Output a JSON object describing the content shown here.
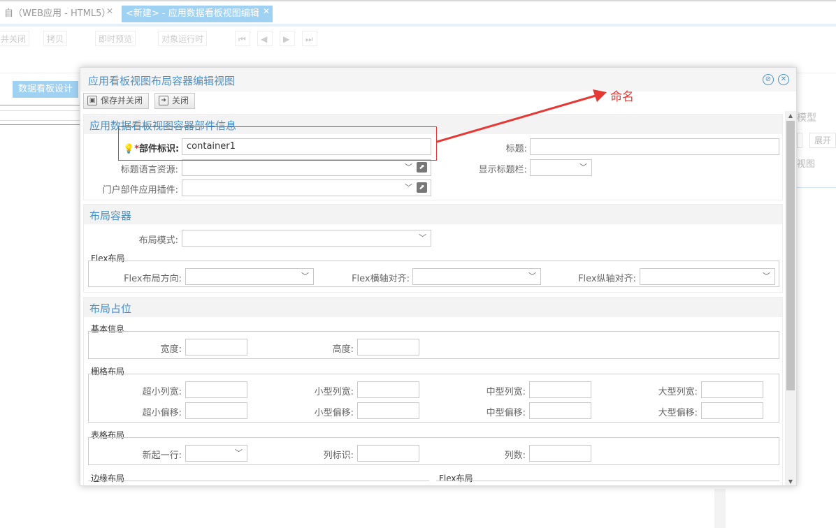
{
  "app": {
    "tabs": [
      {
        "label": "自（WEB应用 - HTML5）",
        "close": "✕"
      },
      {
        "label": "<新建> - 应用数据看板视图编辑",
        "close": "✕"
      }
    ],
    "toolbar": [
      "并关闭",
      "拷贝",
      "即时预览",
      "对象运行时"
    ],
    "design_tab": "数据看板设计",
    "right_model": "模型",
    "right_expand": "展开",
    "right_view": "视图"
  },
  "dialog": {
    "title": "应用看板视图布局容器编辑视图",
    "toolbar": {
      "save_close": "保存并关闭",
      "close": "关闭"
    }
  },
  "section_info": {
    "title": "应用数据看板视图容器部件信息",
    "part_id_label": "部件标识",
    "required_mark": "*",
    "part_id_value": "container1",
    "title_label": "标题:",
    "title_value": "",
    "lang_res_label": "标题语言资源:",
    "show_title_bar_label": "显示标题栏:",
    "portal_plugin_label": "门户部件应用插件:"
  },
  "section_layout": {
    "title": "布局容器",
    "layout_mode_label": "布局模式:",
    "flex_legend": "Flex布局",
    "flex_direction_label": "Flex布局方向:",
    "flex_h_align_label": "Flex横轴对齐:",
    "flex_v_align_label": "Flex纵轴对齐:"
  },
  "section_pos": {
    "title": "布局占位",
    "basic_legend": "基本信息",
    "width_label": "宽度:",
    "height_label": "高度:",
    "grid_legend": "栅格布局",
    "xs_col_label": "超小列宽:",
    "sm_col_label": "小型列宽:",
    "md_col_label": "中型列宽:",
    "lg_col_label": "大型列宽:",
    "xs_off_label": "超小偏移:",
    "sm_off_label": "小型偏移:",
    "md_off_label": "中型偏移:",
    "lg_off_label": "大型偏移:",
    "table_legend": "表格布局",
    "new_row_label": "新起一行:",
    "col_id_label": "列标识:",
    "col_count_label": "列数:",
    "edge_legend": "边缘布局",
    "flex_legend2": "Flex布局"
  },
  "annotation": {
    "text": "命名"
  },
  "colors": {
    "accent": "#4a90c8",
    "annotation": "#e53935"
  }
}
